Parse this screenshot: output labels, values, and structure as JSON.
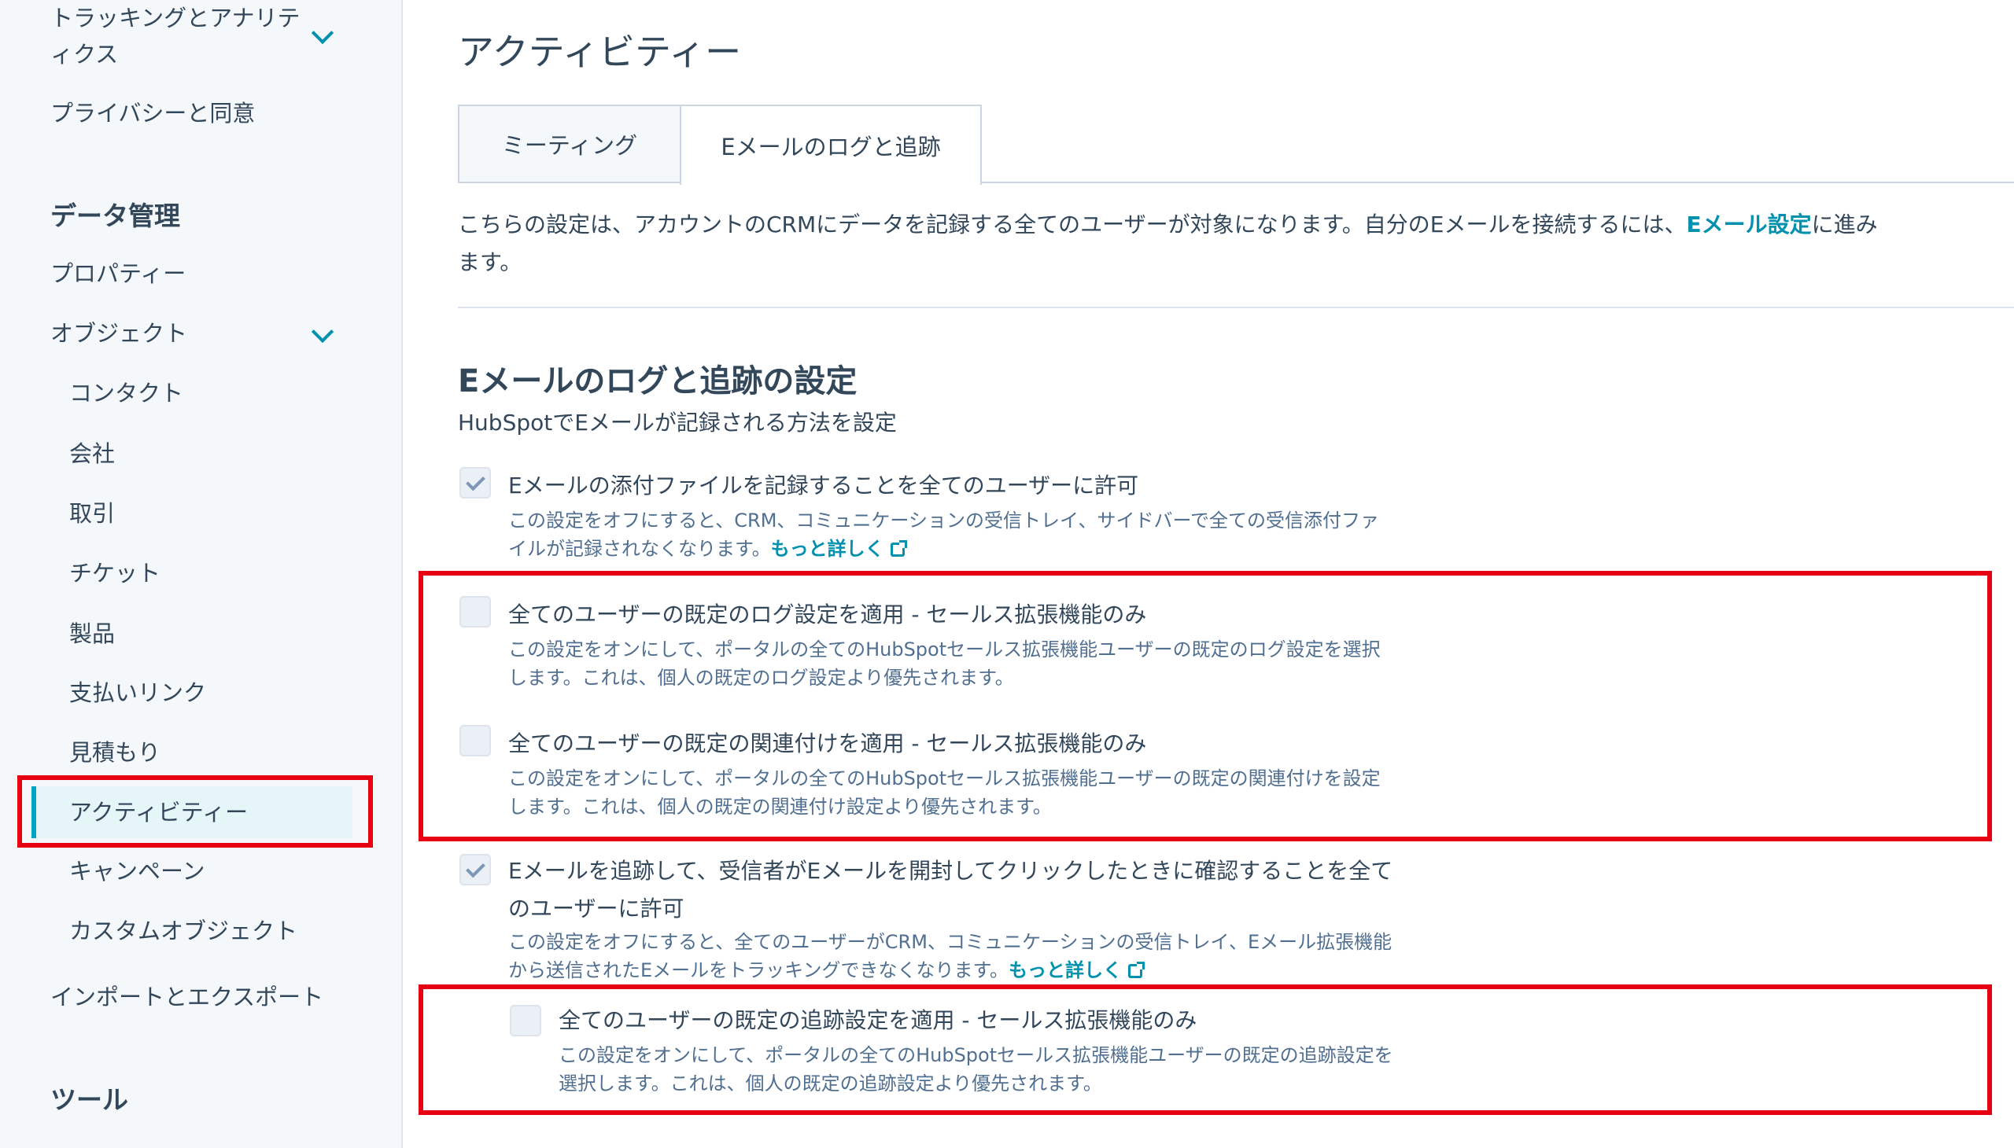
{
  "sidebar": {
    "tracking_label": "トラッキングとアナリティクス",
    "tracking_line1": "トラッキングとアナリテ",
    "tracking_line2": "ィクス",
    "privacy": "プライバシーと同意",
    "data_section": "データ管理",
    "properties": "プロパティー",
    "objects": "オブジェクト",
    "object_items": [
      "コンタクト",
      "会社",
      "取引",
      "チケット",
      "製品",
      "支払いリンク",
      "見積もり",
      "アクティビティー",
      "キャンペーン",
      "カスタムオブジェクト"
    ],
    "import_export": "インポートとエクスポート",
    "tools_section": "ツール"
  },
  "main": {
    "title": "アクティビティー",
    "tabs": [
      {
        "label": "ミーティング",
        "active": false
      },
      {
        "label": "Eメールのログと追跡",
        "active": true
      }
    ],
    "intro_text": "こちらの設定は、アカウントのCRMにデータを記録する全てのユーザーが対象になります。自分のEメールを接続するには、",
    "intro_link": "Eメール設定",
    "intro_suffix": "に進みます。",
    "section_title": "Eメールのログと追跡の設定",
    "section_subtitle": "HubSpotでEメールが記録される方法を設定",
    "learn_more": "もっと詳しく",
    "options": [
      {
        "label": "Eメールの添付ファイルを記録することを全てのユーザーに許可",
        "desc": "この設定をオフにすると、CRM、コミュニケーションの受信トレイ、サイドバーで全ての受信添付ファイルが記録されなくなります。",
        "checked": true
      },
      {
        "label": "全てのユーザーの既定のログ設定を適用 - セールス拡張機能のみ",
        "desc": "この設定をオンにして、ポータルの全てのHubSpotセールス拡張機能ユーザーの既定のログ設定を選択します。これは、個人の既定のログ設定より優先されます。",
        "checked": false
      },
      {
        "label": "全てのユーザーの既定の関連付けを適用 - セールス拡張機能のみ",
        "desc": "この設定をオンにして、ポータルの全てのHubSpotセールス拡張機能ユーザーの既定の関連付けを設定します。これは、個人の既定の関連付け設定より優先されます。",
        "checked": false
      },
      {
        "label": "Eメールを追跡して、受信者がEメールを開封してクリックしたときに確認することを全てのユーザーに許可",
        "desc": "この設定をオフにすると、全てのユーザーがCRM、コミュニケーションの受信トレイ、Eメール拡張機能から送信されたEメールをトラッキングできなくなります。",
        "checked": true
      },
      {
        "label": "全てのユーザーの既定の追跡設定を適用 - セールス拡張機能のみ",
        "desc": "この設定をオンにして、ポータルの全てのHubSpotセールス拡張機能ユーザーの既定の追跡設定を選択します。これは、個人の既定の追跡設定より優先されます。",
        "checked": false
      }
    ]
  }
}
